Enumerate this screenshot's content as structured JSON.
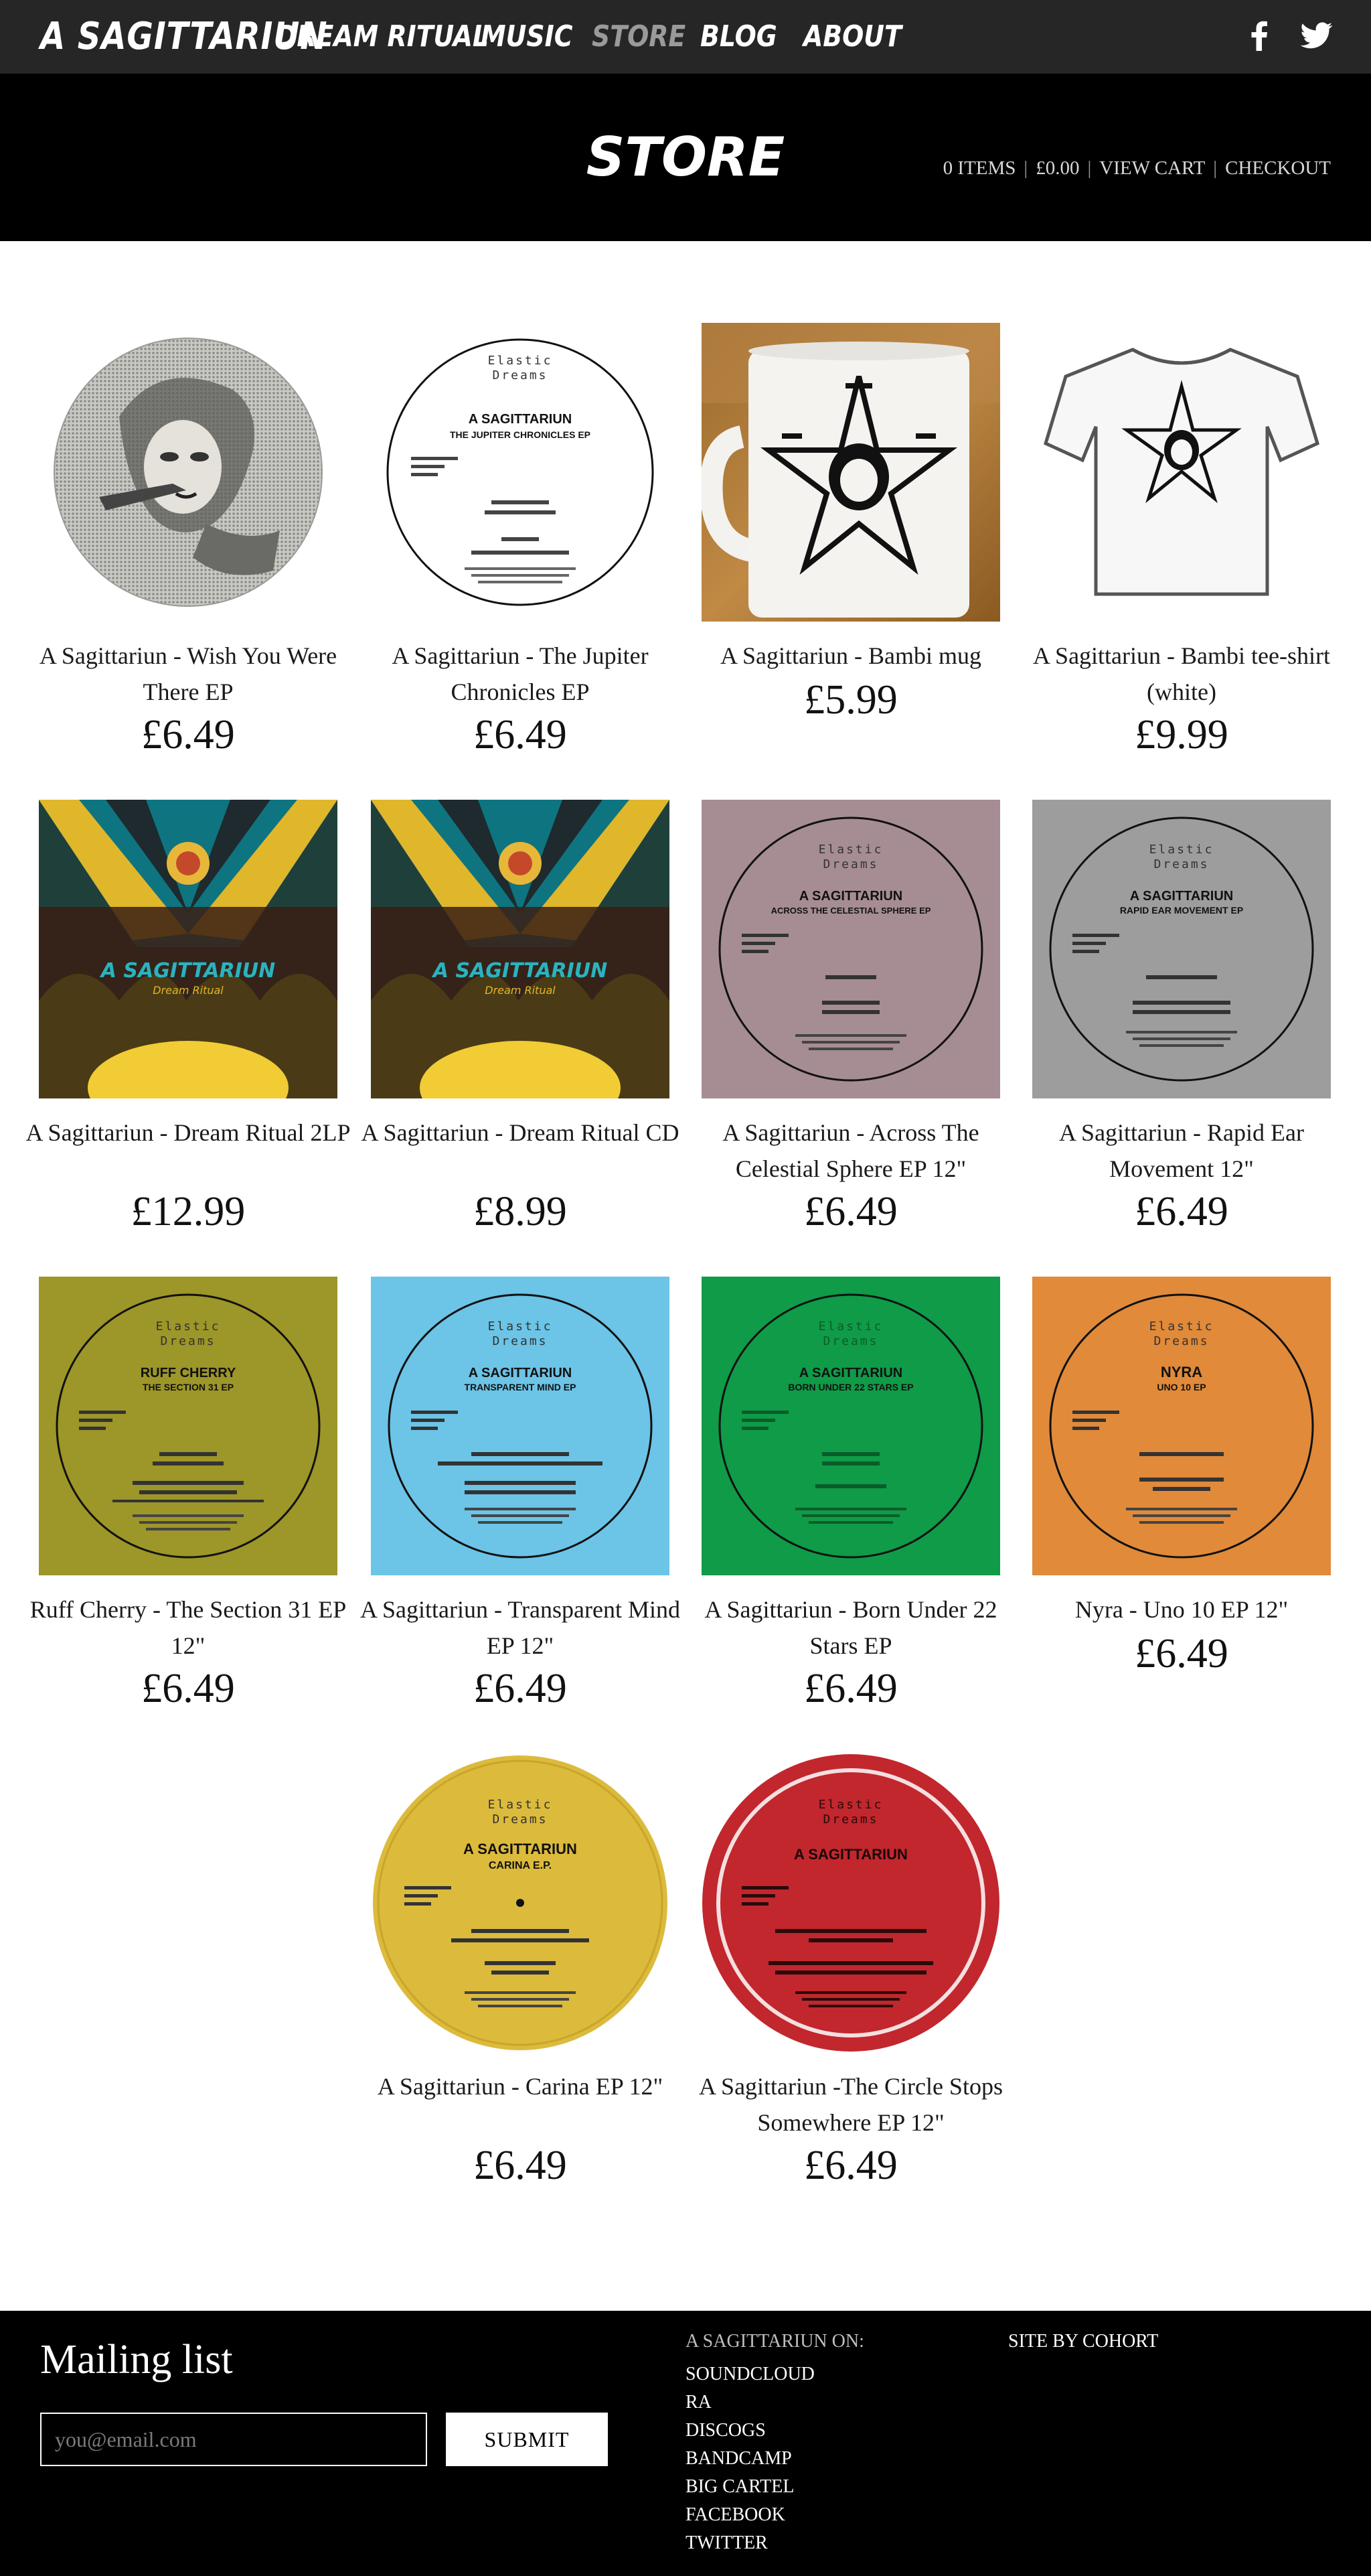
{
  "brand": "A Sagittariun",
  "nav": [
    {
      "label": "Dream Ritual",
      "active": false
    },
    {
      "label": "Music",
      "active": false
    },
    {
      "label": "Store",
      "active": true
    },
    {
      "label": "Blog",
      "active": false
    },
    {
      "label": "About",
      "active": false
    }
  ],
  "social": [
    "facebook-icon",
    "twitter-icon"
  ],
  "page_title": "Store",
  "cart": {
    "items": "0 ITEMS",
    "total": "£0.00",
    "view_cart": "VIEW CART",
    "checkout": "CHECKOUT"
  },
  "products": [
    {
      "name": "A Sagittariun - Wish You Were There EP",
      "price": "£6.49"
    },
    {
      "name": "A Sagittariun - The Jupiter Chronicles EP",
      "price": "£6.49"
    },
    {
      "name": "A Sagittariun - Bambi mug",
      "price": "£5.99"
    },
    {
      "name": "A Sagittariun - Bambi tee-shirt (white)",
      "price": "£9.99"
    },
    {
      "name": "A Sagittariun - Dream Ritual 2LP",
      "price": "£12.99"
    },
    {
      "name": "A Sagittariun - Dream Ritual CD",
      "price": "£8.99"
    },
    {
      "name": "A Sagittariun - Across The Celestial Sphere EP 12\"",
      "price": "£6.49"
    },
    {
      "name": "A Sagittariun - Rapid Ear Movement 12\"",
      "price": "£6.49"
    },
    {
      "name": "Ruff Cherry - The Section 31 EP 12\"",
      "price": "£6.49"
    },
    {
      "name": "A Sagittariun - Transparent Mind EP 12\"",
      "price": "£6.49"
    },
    {
      "name": "A Sagittariun - Born Under 22 Stars EP",
      "price": "£6.49"
    },
    {
      "name": "Nyra - Uno 10 EP 12\"",
      "price": "£6.49"
    },
    {
      "name": "A Sagittariun - Carina EP 12\"",
      "price": "£6.49"
    },
    {
      "name": "A Sagittariun -The Circle Stops Somewhere EP 12\"",
      "price": "£6.49"
    }
  ],
  "labels": {
    "elastic": "Elastic",
    "dreams": "Dreams",
    "jupiter_artist": "A SAGITTARIUN",
    "jupiter_title": "THE JUPITER CHRONICLES EP",
    "celestial_artist": "A SAGITTARIUN",
    "celestial_title": "ACROSS THE CELESTIAL SPHERE EP",
    "rem_artist": "A SAGITTARIUN",
    "rem_title": "RAPID EAR MOVEMENT EP",
    "ruff_artist": "RUFF CHERRY",
    "ruff_title": "THE SECTION 31 EP",
    "transparent_artist": "A SAGITTARIUN",
    "transparent_title": "TRANSPARENT MIND EP",
    "born_artist": "A SAGITTARIUN",
    "born_title": "BORN UNDER 22 STARS EP",
    "nyra_artist": "NYRA",
    "nyra_title": "UNO 10 EP",
    "carina_artist": "A SAGITTARIUN",
    "carina_title": "CARINA E.P.",
    "circle_artist": "A SAGITTARIUN",
    "cover_artist": "A SAGITTARIUN",
    "cover_title": "Dream Ritual"
  },
  "footer": {
    "mailing_title": "Mailing list",
    "email_placeholder": "you@email.com",
    "submit_label": "SUBMIT",
    "links_heading": "A SAGITTARIUN ON:",
    "links": [
      "SOUNDCLOUD",
      "RA",
      "DISCOGS",
      "BANDCAMP",
      "BIG CARTEL",
      "FACEBOOK",
      "TWITTER"
    ],
    "site_by": "SITE BY COHORT"
  },
  "colors": {
    "nav_bg": "#262626",
    "header_bg": "#000000",
    "active_nav": "#9a9a9a",
    "celestial": "#a68d93",
    "rem": "#9c9d9c",
    "ruff": "#9d9628",
    "transparent": "#6cc4e6",
    "born": "#0f9b47",
    "nyra": "#e08a3a",
    "carina": "#dcba3c",
    "circle": "#c1272d"
  }
}
